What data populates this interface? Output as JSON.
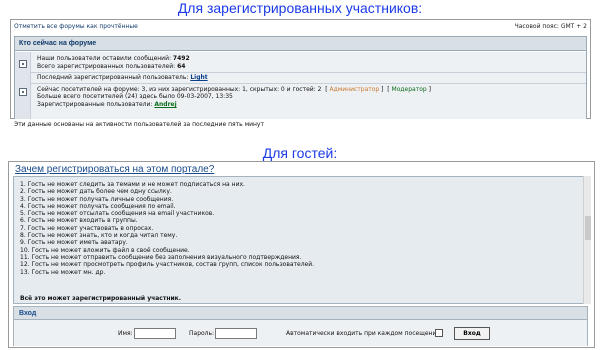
{
  "captions": {
    "registered": "Для зарегистрированных участников:",
    "guests": "Для гостей:"
  },
  "registered_view": {
    "mark_read_link": "Отметить все форумы как прочтённые",
    "timezone": "Часовой пояс: GMT + 2",
    "who_online": {
      "title": "Кто сейчас на форуме",
      "stats": {
        "posts_label": "Наши пользователи оставили сообщений:",
        "posts_value": "7492",
        "users_label": "Всего зарегистрированных пользователей:",
        "users_value": "64",
        "latest_label": "Последний зарегистрированный пользователь:",
        "latest_user": "Light"
      },
      "online_line_1": "Сейчас посетителей на форуме: 3, из них зарегистрированных: 1, скрытых: 0 и гостей: 2",
      "admin_label": "Администратор",
      "moderator_label": "Модератор",
      "online_line_2": "Больше всего посетителей (24) здесь было 09-03-2007, 13:35",
      "registered_users_label": "Зарегистрированные пользователи:",
      "registered_user": "Andrej"
    },
    "footnote": "Эти данные основаны на активности пользователей за последние пять минут"
  },
  "guest_view": {
    "why_title": "Зачем регистрироваться на этом портале?",
    "reasons": [
      "1. Гость не может следить за темами и не может подписаться на них.",
      "2. Гость не может дать более чем одну ссылку.",
      "3. Гость не может получать личные сообщения.",
      "4. Гость не может получать сообщения по email.",
      "5. Гость не может отсылать сообщения на email участников.",
      "6. Гость не может входить в группы.",
      "7. Гость не может участвовать в опросах.",
      "8. Гость не может знать, кто и когда читал тему.",
      "9. Гость не может иметь аватару.",
      "10. Гость не может вложить файл в своё сообщение.",
      "11. Гость не может отправить сообщение без заполнения визуального подтверждения.",
      "12. Гость не может просмотреть профиль участников, состав групп, список пользователей.",
      "13. Гость не может мн. др."
    ],
    "final_note": "Всё это может зарегистрированный участник.",
    "login": {
      "title": "Вход",
      "username_label": "Имя:",
      "password_label": "Пароль:",
      "autologin_label": "Автоматически входить при каждом посещении",
      "submit_label": "Вход",
      "username_value": "",
      "password_value": ""
    }
  }
}
